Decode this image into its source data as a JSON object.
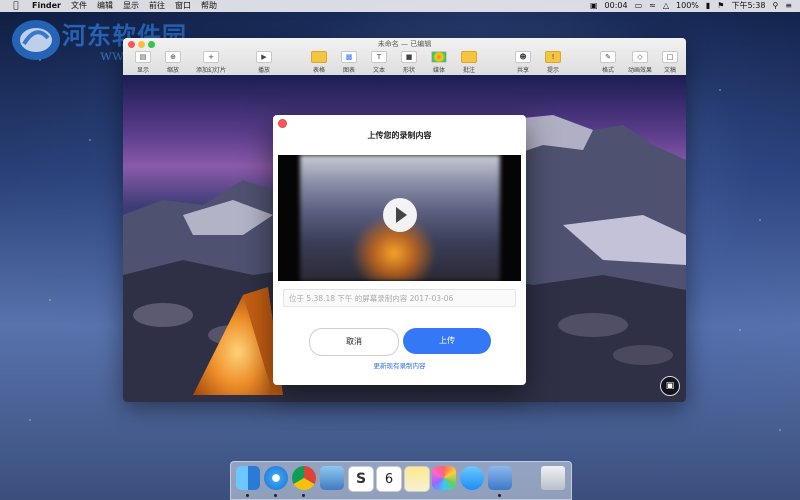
{
  "menubar": {
    "apple_icon": "apple-logo",
    "app_name": "Finder",
    "items": [
      "文件",
      "编辑",
      "显示",
      "前往",
      "窗口",
      "帮助"
    ],
    "time_left": "00:04",
    "battery": "100%",
    "clock": "下午5:38"
  },
  "watermark": {
    "text": "河东软件园",
    "url": "www.pc0359.cn"
  },
  "window": {
    "doc_title": "未命名 — 已编辑",
    "toolbar": [
      {
        "label": "显示",
        "icon": "view-icon"
      },
      {
        "label": "缩放",
        "icon": "zoom-icon"
      },
      {
        "label": "添加幻灯片",
        "icon": "add-slide-icon"
      },
      {
        "label": "播放",
        "icon": "play-icon"
      },
      {
        "label": "表格",
        "icon": "table-icon"
      },
      {
        "label": "图表",
        "icon": "chart-icon"
      },
      {
        "label": "文本",
        "icon": "text-icon"
      },
      {
        "label": "形状",
        "icon": "shape-icon"
      },
      {
        "label": "媒体",
        "icon": "media-icon"
      },
      {
        "label": "批注",
        "icon": "comment-icon"
      },
      {
        "label": "共享",
        "icon": "share-icon"
      },
      {
        "label": "提示",
        "icon": "tips-icon"
      },
      {
        "label": "格式",
        "icon": "format-icon"
      },
      {
        "label": "动画效果",
        "icon": "animate-icon"
      },
      {
        "label": "文稿",
        "icon": "document-icon"
      }
    ]
  },
  "modal": {
    "title": "上传您的录制内容",
    "title_placeholder": "位于 5.38.18 下午 的屏幕录制内容 2017-03-06",
    "cancel_label": "取消",
    "upload_label": "上传",
    "link_label": "更新现有录制内容"
  },
  "dock": {
    "apps": [
      "finder",
      "safari",
      "chrome",
      "preview",
      "slack",
      "calendar",
      "notes",
      "photos",
      "messages",
      "keynote",
      "trash"
    ],
    "calendar_day": "6"
  },
  "colors": {
    "accent": "#3478f6",
    "close": "#fc5753"
  }
}
